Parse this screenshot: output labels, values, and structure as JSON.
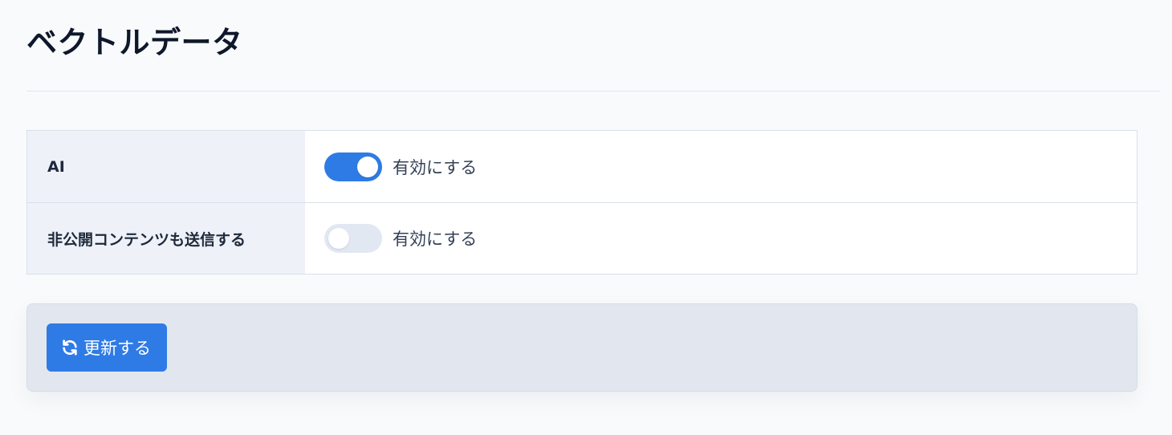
{
  "page": {
    "title": "ベクトルデータ"
  },
  "settings": {
    "rows": [
      {
        "label": "AI",
        "toggle_label": "有効にする",
        "enabled": true
      },
      {
        "label": "非公開コンテンツも送信する",
        "toggle_label": "有効にする",
        "enabled": false
      }
    ]
  },
  "actions": {
    "update_label": "更新する",
    "update_icon": "refresh-icon"
  },
  "colors": {
    "accent": "#2f7be6",
    "toggle_off": "#e2e8f2",
    "label_bg": "#eef2f8",
    "action_bar_bg": "#e2e7ef"
  }
}
